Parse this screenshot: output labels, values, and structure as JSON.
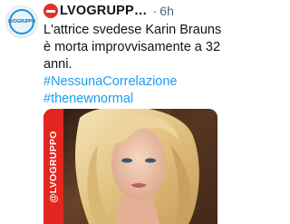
{
  "tweet": {
    "avatar_text": "LVOGRUPPO",
    "author_name": "LVOGRUPP…",
    "separator": "·",
    "timestamp": "6h",
    "text_line1": "L'attrice svedese Karin Brauns",
    "text_line2": "è morta improvvisamente a 32",
    "text_line3": "anni.",
    "hashtags": [
      "#NessunaCorrelazione",
      "#thenewnormal"
    ]
  },
  "media": {
    "watermark_text": "@LVOGRUPPO",
    "description_colors": {
      "watermark_bg": "#e3261f",
      "hair": "#e9cf93",
      "skin": "#f0c9b0",
      "background": "#3a2418"
    }
  },
  "colors": {
    "hashtag": "#1d9bf0",
    "text": "#0f1419",
    "muted": "#536471",
    "warning_badge": "#e0312b"
  }
}
